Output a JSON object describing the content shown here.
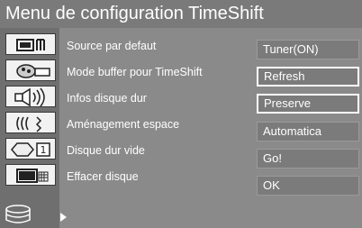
{
  "title": "Menu de configuration TimeShift",
  "rows": [
    {
      "label": "Source par defaut",
      "icon": "tv-source-icon",
      "value": "Tuner(ON)",
      "selected": false
    },
    {
      "label": "Mode buffer pour TimeShift",
      "icon": "buffer-mode-icon",
      "value": "Refresh",
      "selected": true
    },
    {
      "label": "Infos disque dur",
      "icon": "disk-info-icon",
      "value": "Preserve",
      "selected": true
    },
    {
      "label": "Aménagement espace",
      "icon": "space-management-icon",
      "value": "Automatica",
      "selected": false
    },
    {
      "label": "Disque dur vide",
      "icon": "empty-disk-icon",
      "value": "Go!",
      "selected": false
    },
    {
      "label": "Effacer disque",
      "icon": "erase-disk-icon",
      "value": "OK",
      "selected": false
    }
  ],
  "icon_badge": "1",
  "colors": {
    "title_bg": "#7a7a7a",
    "panel_bg": "#8a8a8a",
    "icon_col_bg": "#6f6f6f",
    "text": "#ffffff"
  }
}
